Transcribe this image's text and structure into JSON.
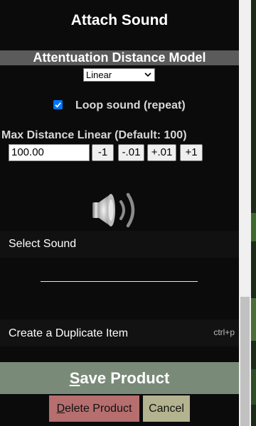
{
  "dialog": {
    "title": "Attach Sound"
  },
  "attenuation": {
    "heading": "Attentuation Distance Model",
    "selected_model": "Linear"
  },
  "loop": {
    "label": "Loop sound (repeat)",
    "checked": true
  },
  "max_distance": {
    "label": "Max Distance Linear (Default: 100)",
    "value": "100.00",
    "buttons": [
      "-1",
      "-.01",
      "+.01",
      "+1"
    ]
  },
  "sound": {
    "icon": "speaker-icon",
    "select_label": "Select Sound"
  },
  "duplicate": {
    "label": "Create a Duplicate Item",
    "shortcut": "ctrl+p"
  },
  "actions": {
    "save_first": "S",
    "save_rest": "ave Product",
    "delete_first": "D",
    "delete_rest": "elete Product",
    "cancel": "Cancel"
  },
  "colors": {
    "background": "#0b0b0b",
    "section_bar": "#5b5b5b",
    "save_button": "#7a8a78",
    "delete_button": "#b66e6e",
    "cancel_button": "#b3b38f",
    "checkbox": "#0075ff"
  }
}
